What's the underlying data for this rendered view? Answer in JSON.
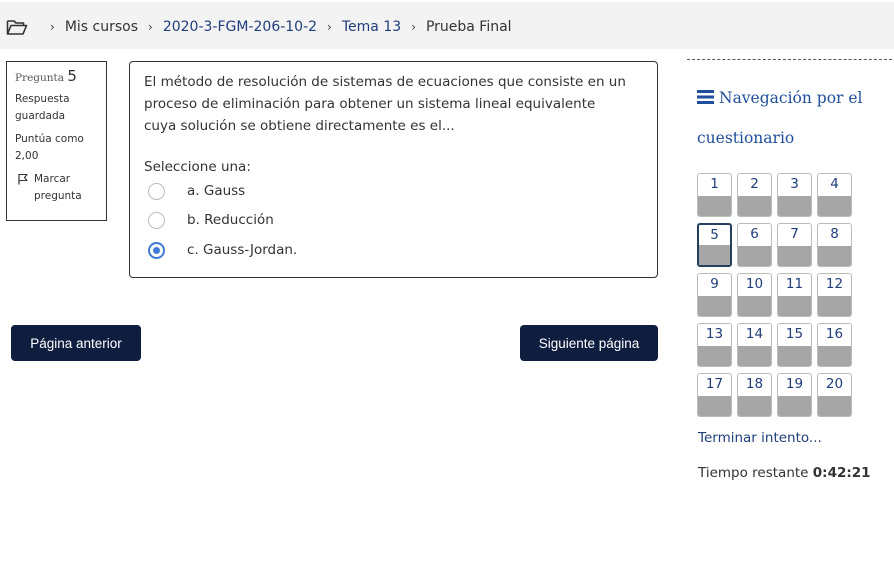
{
  "breadcrumb": {
    "items": [
      {
        "label": "Mis cursos"
      },
      {
        "label": "2020-3-FGM-206-10-2"
      },
      {
        "label": "Tema 13"
      },
      {
        "label": "Prueba Final"
      }
    ],
    "separator": "›",
    "icon": "folder-open-icon"
  },
  "info": {
    "question_label": "Pregunta",
    "question_number": "5",
    "state": "Respuesta guardada",
    "grade": "Puntúa como 2,00",
    "flag_label": "Marcar pregunta"
  },
  "question": {
    "text": "El método de resolución de sistemas de ecuaciones que consiste en un proceso de eliminación para obtener un sistema lineal equivalente cuya solución se obtiene directamente es el...",
    "prompt": "Seleccione una:",
    "answers": [
      {
        "label": "a. Gauss",
        "checked": false
      },
      {
        "label": "b. Reducción",
        "checked": false
      },
      {
        "label": "c. Gauss-Jordan.",
        "checked": true
      }
    ],
    "accent_color": "#3e7ad6"
  },
  "buttons": {
    "prev": "Página anterior",
    "next": "Siguiente página"
  },
  "navigation": {
    "title": "Navegación por el cuestionario",
    "questions": [
      "1",
      "2",
      "3",
      "4",
      "5",
      "6",
      "7",
      "8",
      "9",
      "10",
      "11",
      "12",
      "13",
      "14",
      "15",
      "16",
      "17",
      "18",
      "19",
      "20"
    ],
    "current": "5",
    "finish_link": "Terminar intento...",
    "timer_label": "Tiempo restante",
    "timer_value": "0:42:21"
  },
  "colors": {
    "button_bg": "#0f1d3f",
    "link": "#1f3e7a",
    "nav_title": "#1f4e9a",
    "answered_state": "#a6a6a6"
  }
}
